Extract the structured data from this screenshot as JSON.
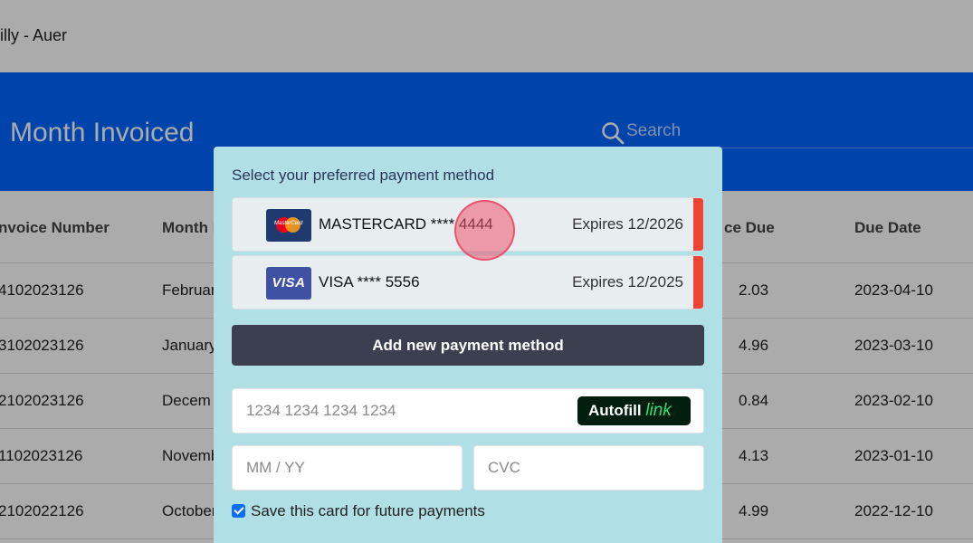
{
  "header": {
    "company": "illy - Auer"
  },
  "hero": {
    "title": "Month Invoiced",
    "search_placeholder": "Search",
    "search_icon": "search-icon"
  },
  "table": {
    "columns": [
      "Invoice Number",
      "Month Invoiced",
      "Balance Due",
      "Due Date"
    ],
    "columns_visible": [
      "nvoice Number",
      "Month I",
      "ce Due",
      "Due Date"
    ],
    "rows": [
      {
        "invoice": "4102023126",
        "month": "Februar",
        "balance": "2.03",
        "due": "2023-04-10"
      },
      {
        "invoice": "3102023126",
        "month": "January",
        "balance": "4.96",
        "due": "2023-03-10"
      },
      {
        "invoice": "2102023126",
        "month": "Decem",
        "balance": "0.84",
        "due": "2023-02-10"
      },
      {
        "invoice": "1102023126",
        "month": "Novemb",
        "balance": "4.13",
        "due": "2023-01-10"
      },
      {
        "invoice": "2102022126",
        "month": "October",
        "balance": "4.99",
        "due": "2022-12-10"
      }
    ]
  },
  "modal": {
    "title": "Select your preferred payment method",
    "cards": [
      {
        "brand": "MASTERCARD",
        "label": "MASTERCARD **** 4444",
        "expires": "Expires 12/2026",
        "logo_text": "MasterCard",
        "icon": "mastercard-logo-icon"
      },
      {
        "brand": "VISA",
        "label": "VISA **** 5556",
        "expires": "Expires 12/2025",
        "logo_text": "VISA",
        "icon": "visa-logo-icon"
      }
    ],
    "add_button": "Add new payment method",
    "card_number_placeholder": "1234 1234 1234 1234",
    "autofill": {
      "label": "Autofill",
      "link": "link"
    },
    "expiry_placeholder": "MM / YY",
    "cvc_placeholder": "CVC",
    "save_card": {
      "label": "Save this card for future payments",
      "checked": true
    }
  },
  "colors": {
    "hero_bg": "#0066ff",
    "modal_bg": "#b0dfe5",
    "card_accent": "#ee4436",
    "button_bg": "#3b3f4f",
    "autofill_bg": "#011e0f",
    "autofill_link": "#33dd77"
  }
}
